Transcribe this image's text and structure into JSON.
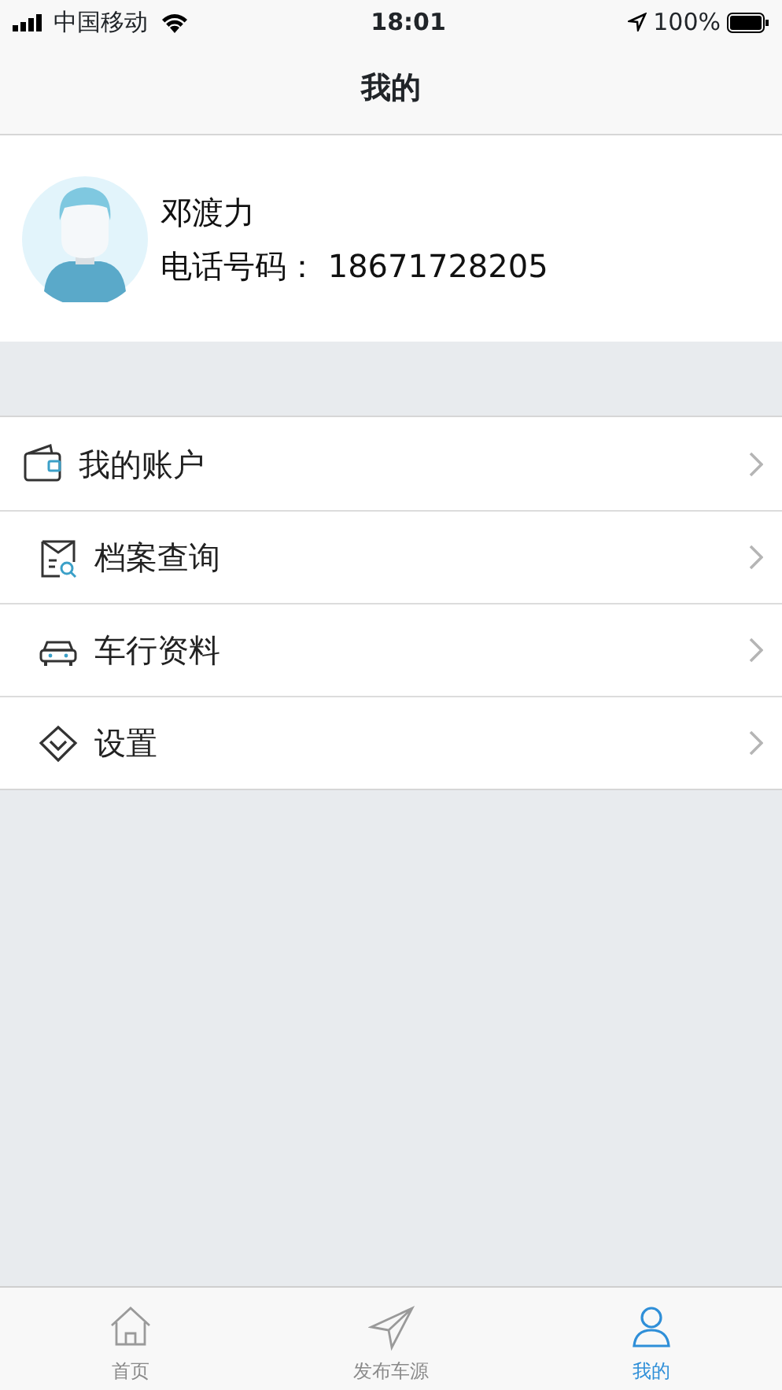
{
  "status_bar": {
    "carrier": "中国移动",
    "time": "18:01",
    "battery": "100%"
  },
  "nav_bar": {
    "title": "我的"
  },
  "profile": {
    "name": "邓渡力",
    "phone": "电话号码：  18671728205"
  },
  "menu": [
    {
      "kind": "wallet",
      "label": "我的账户"
    },
    {
      "kind": "archive",
      "label": "档案查询"
    },
    {
      "kind": "car",
      "label": "车行资料"
    },
    {
      "kind": "diamond",
      "label": "设置"
    }
  ],
  "tab_bar": [
    {
      "kind": "home",
      "label": "首页",
      "selected": false
    },
    {
      "kind": "send",
      "label": "发布车源",
      "selected": false
    },
    {
      "kind": "person",
      "label": "我的",
      "selected": true
    }
  ]
}
